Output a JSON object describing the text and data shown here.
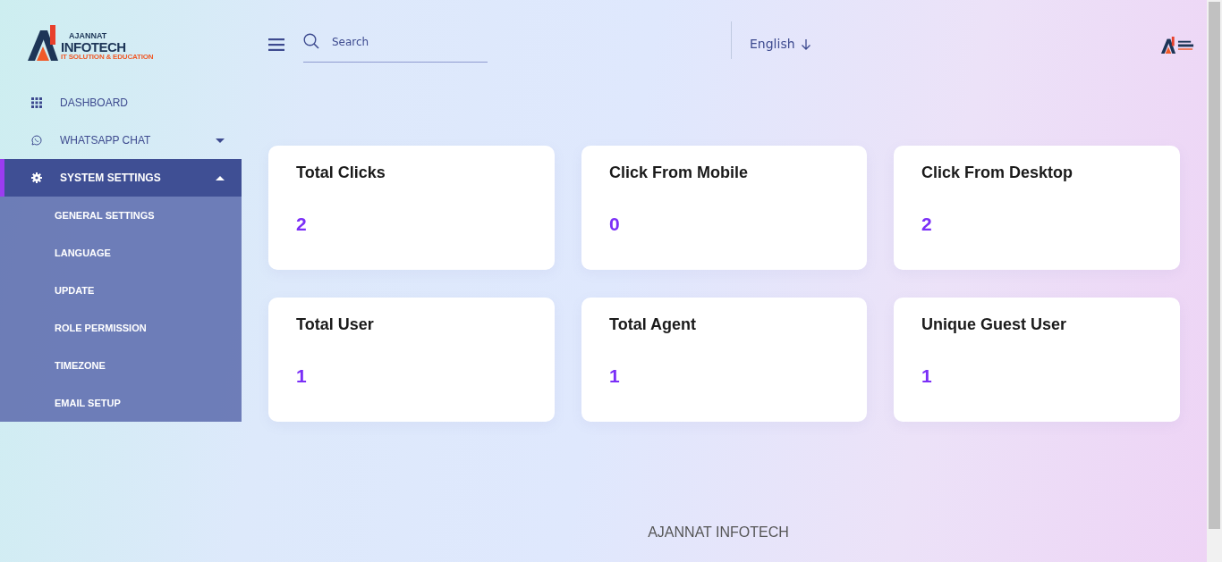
{
  "brand": {
    "name": "AJANNAT",
    "name_line2": "INFOTECH",
    "tagline": "IT SOLUTION & EDUCATION"
  },
  "sidebar": {
    "items": [
      {
        "kind": "link",
        "label": "DASHBOARD",
        "selected": false
      },
      {
        "kind": "group",
        "label": "WHATSAPP CHAT",
        "selected": false,
        "expanded": false
      },
      {
        "kind": "group",
        "label": "SYSTEM SETTINGS",
        "selected": true,
        "expanded": true,
        "children": [
          {
            "label": "GENERAL SETTINGS",
            "selected": false
          },
          {
            "label": "LANGUAGE",
            "selected": false
          },
          {
            "label": "UPDATE",
            "selected": false
          },
          {
            "label": "ROLE PERMISSION",
            "selected": false
          },
          {
            "label": "TIMEZONE",
            "selected": false
          },
          {
            "label": "EMAIL SETUP",
            "selected": false
          }
        ]
      }
    ]
  },
  "header": {
    "search": {
      "placeholder": "Search"
    },
    "language": {
      "label": "English"
    }
  },
  "stats": [
    {
      "title": "Total Clicks",
      "value": "2"
    },
    {
      "title": "Click From Mobile",
      "value": "0"
    },
    {
      "title": "Click From Desktop",
      "value": "2"
    },
    {
      "title": "Total User",
      "value": "1"
    },
    {
      "title": "Total Agent",
      "value": "1"
    },
    {
      "title": "Unique Guest User",
      "value": "1"
    }
  ],
  "footer": {
    "text": "AJANNAT INFOTECH"
  }
}
